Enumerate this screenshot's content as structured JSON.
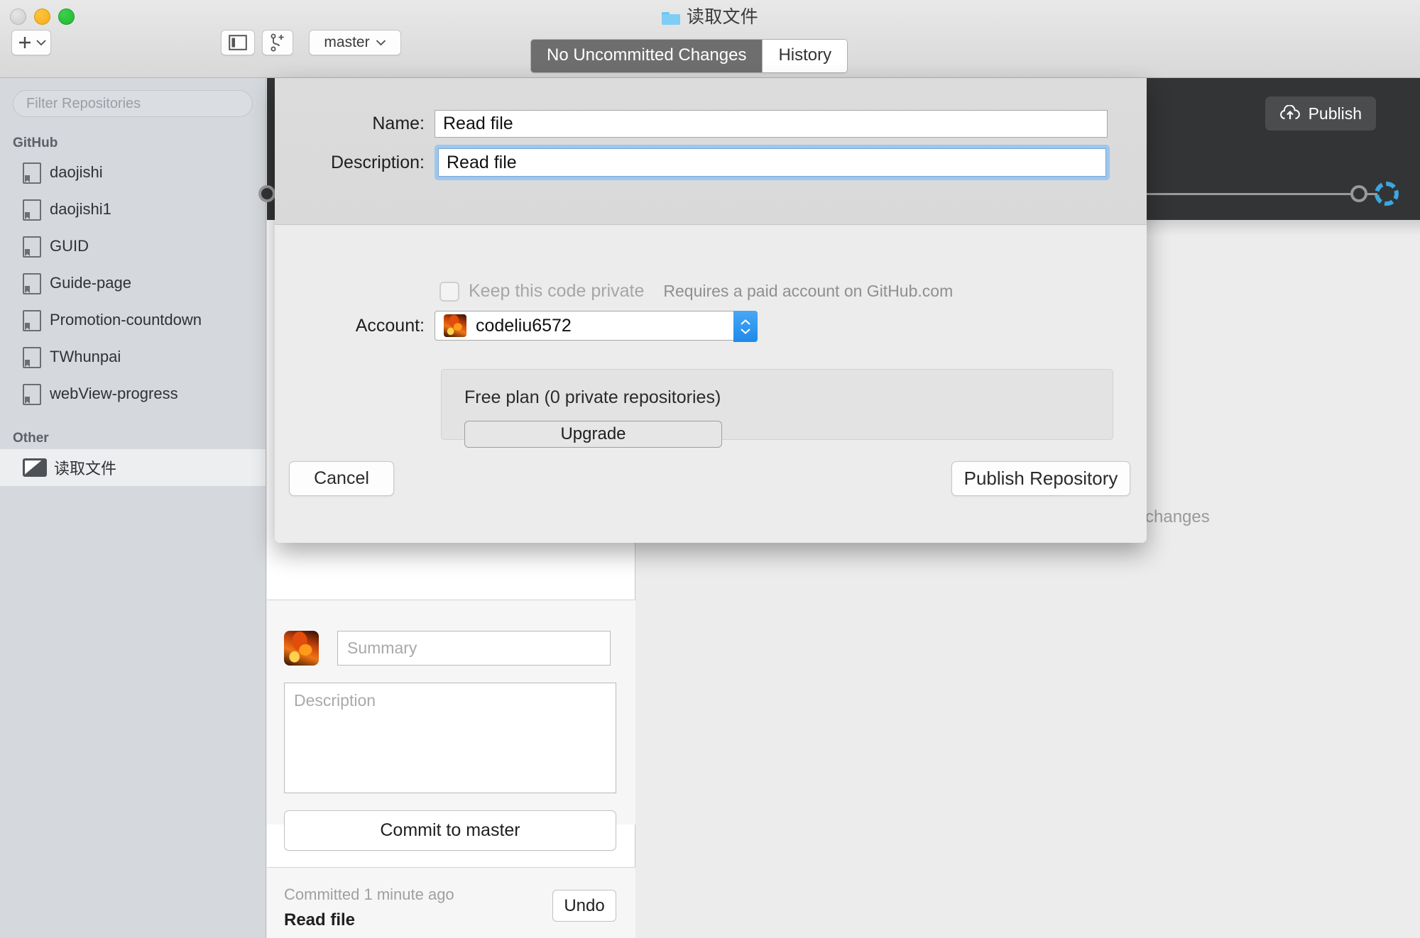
{
  "window": {
    "title": "读取文件",
    "title_icon": "folder-icon",
    "traffic_lights": [
      "close",
      "minimize",
      "maximize"
    ]
  },
  "toolbar": {
    "add_label": "+",
    "add_icon": "plus-icon",
    "add_chevron_icon": "chevron-down-icon",
    "panel_toggle_icon": "sidebar-toggle-icon",
    "new_branch_icon": "branch-plus-icon",
    "branch_name": "master",
    "branch_chevron_icon": "chevron-down-icon"
  },
  "tabs": [
    {
      "label": "No Uncommitted Changes",
      "active": true
    },
    {
      "label": "History",
      "active": false
    }
  ],
  "sidebar": {
    "filter_placeholder": "Filter Repositories",
    "groups": [
      {
        "label": "GitHub",
        "items": [
          {
            "label": "daojishi",
            "icon": "repo-book-icon",
            "selected": false
          },
          {
            "label": "daojishi1",
            "icon": "repo-book-icon",
            "selected": false
          },
          {
            "label": "GUID",
            "icon": "repo-book-icon",
            "selected": false
          },
          {
            "label": "Guide-page",
            "icon": "repo-book-icon",
            "selected": false
          },
          {
            "label": "Promotion-countdown",
            "icon": "repo-book-icon",
            "selected": false
          },
          {
            "label": "TWhunpai",
            "icon": "repo-book-icon",
            "selected": false
          },
          {
            "label": "webView-progress",
            "icon": "repo-book-icon",
            "selected": false
          }
        ]
      },
      {
        "label": "Other",
        "items": [
          {
            "label": "读取文件",
            "icon": "monitor-icon",
            "selected": true
          }
        ]
      }
    ]
  },
  "history_strip": {
    "publish_label": "Publish",
    "publish_icon": "cloud-upload-icon",
    "nodes": 2,
    "pending_node_color": "#3ba7e0"
  },
  "main": {
    "no_changes_text": "changes"
  },
  "commit_panel": {
    "summary_placeholder": "Summary",
    "description_placeholder": "Description",
    "commit_button_label": "Commit to master",
    "avatar_icon": "user-avatar",
    "last_commit": {
      "time_text": "Committed 1 minute ago",
      "message": "Read file",
      "undo_label": "Undo"
    }
  },
  "publish_dialog": {
    "name_label": "Name:",
    "name_value": "Read file",
    "description_label": "Description:",
    "description_value": "Read file",
    "description_focused": true,
    "private_checkbox_label": "Keep this code private",
    "private_checkbox_checked": false,
    "private_hint": "Requires a paid account on GitHub.com",
    "account_label": "Account:",
    "account_value": "codeliu6572",
    "account_avatar_icon": "user-avatar",
    "stepper_icon": "stepper-up-down-icon",
    "plan_text": "Free plan (0 private repositories)",
    "upgrade_label": "Upgrade",
    "cancel_label": "Cancel",
    "publish_label": "Publish Repository"
  },
  "colors": {
    "accent": "#1f8ae8",
    "focus_ring": "#9dc7ee",
    "dark_strip": "#333435",
    "sidebar_bg": "#d5d8dd",
    "tab_active_bg": "#6e6e6e"
  }
}
